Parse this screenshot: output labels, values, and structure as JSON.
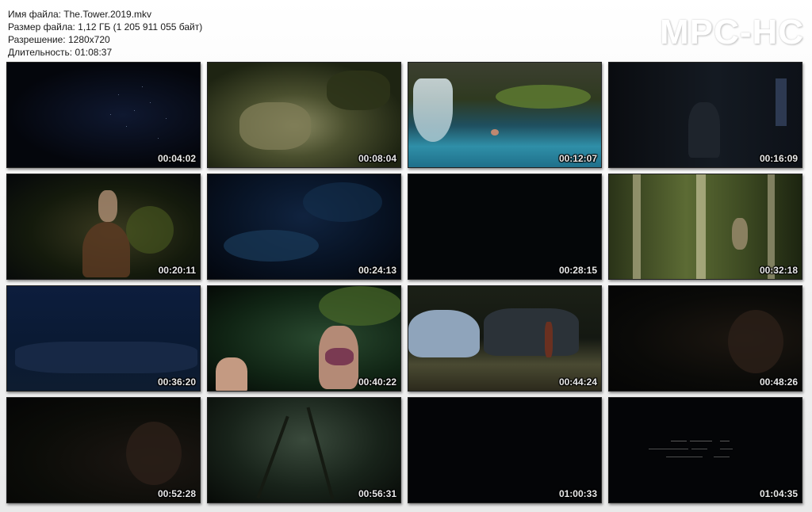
{
  "file_info": {
    "name_line": "Имя файла: The.Tower.2019.mkv",
    "size_line": "Размер файла: 1,12 ГБ (1 205 911 055 байт)",
    "resolution_line": "Разрешение: 1280x720",
    "duration_line": "Длительность: 01:08:37"
  },
  "logo": {
    "text": "MPC-HC"
  },
  "thumbnails": [
    {
      "timestamp": "00:04:02"
    },
    {
      "timestamp": "00:08:04"
    },
    {
      "timestamp": "00:12:07"
    },
    {
      "timestamp": "00:16:09"
    },
    {
      "timestamp": "00:20:11"
    },
    {
      "timestamp": "00:24:13"
    },
    {
      "timestamp": "00:28:15"
    },
    {
      "timestamp": "00:32:18"
    },
    {
      "timestamp": "00:36:20"
    },
    {
      "timestamp": "00:40:22"
    },
    {
      "timestamp": "00:44:24"
    },
    {
      "timestamp": "00:48:26"
    },
    {
      "timestamp": "00:52:28"
    },
    {
      "timestamp": "00:56:31"
    },
    {
      "timestamp": "01:00:33"
    },
    {
      "timestamp": "01:04:35"
    }
  ]
}
